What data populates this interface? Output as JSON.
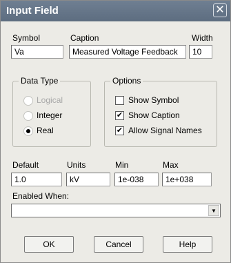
{
  "window": {
    "title": "Input Field",
    "close_glyph": "✕"
  },
  "symbol": {
    "label": "Symbol",
    "value": "Va"
  },
  "caption": {
    "label": "Caption",
    "value": "Measured Voltage Feedback"
  },
  "width": {
    "label": "Width",
    "value": "10"
  },
  "data_type": {
    "legend": "Data Type",
    "options": [
      "Logical",
      "Integer",
      "Real"
    ],
    "selected": "Real"
  },
  "options_group": {
    "legend": "Options",
    "show_symbol": {
      "label": "Show Symbol",
      "checked": false
    },
    "show_caption": {
      "label": "Show Caption",
      "checked": true
    },
    "allow_signal_names": {
      "label": "Allow Signal Names",
      "checked": true
    }
  },
  "default": {
    "label": "Default",
    "value": "1.0"
  },
  "units": {
    "label": "Units",
    "value": "kV"
  },
  "min": {
    "label": "Min",
    "value": "1e-038"
  },
  "max": {
    "label": "Max",
    "value": "1e+038"
  },
  "enabled_when": {
    "label": "Enabled When:",
    "value": ""
  },
  "buttons": {
    "ok": "OK",
    "cancel": "Cancel",
    "help": "Help"
  }
}
